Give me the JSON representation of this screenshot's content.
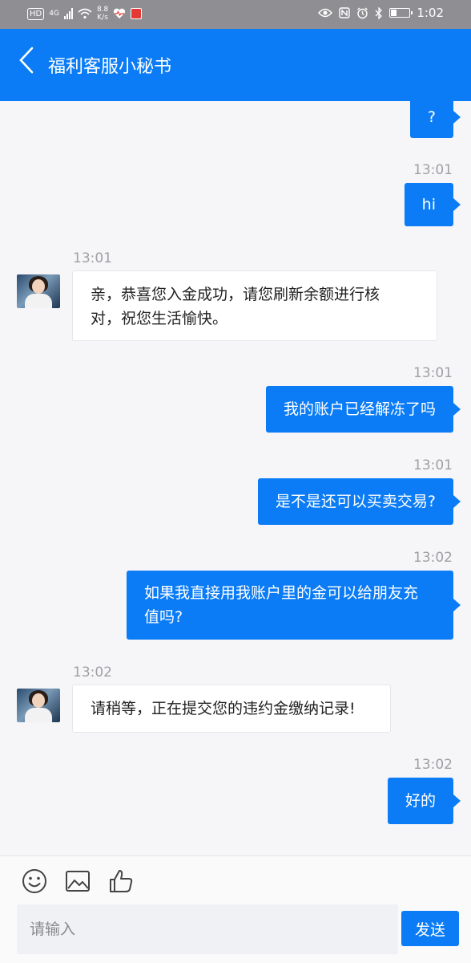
{
  "status_bar": {
    "hd": "HD",
    "network": "4G",
    "speed_top": "8.8",
    "speed_bottom": "K/s",
    "battery_level": 0.3,
    "time": "1:02"
  },
  "header": {
    "title": "福利客服小秘书"
  },
  "messages": [
    {
      "side": "out",
      "text": "?"
    },
    {
      "side": "out",
      "time": "13:01",
      "text": "hi"
    },
    {
      "side": "in",
      "time": "13:01",
      "text_lines": [
        "亲，恭喜您入金成功，请您刷新余额进行核",
        "对，祝您生活愉快。"
      ]
    },
    {
      "side": "out",
      "time": "13:01",
      "text": "我的账户已经解冻了吗"
    },
    {
      "side": "out",
      "time": "13:01",
      "text": "是不是还可以买卖交易?"
    },
    {
      "side": "out",
      "time": "13:02",
      "text_lines": [
        "如果我直接用我账户里的金可以给朋友充",
        "值吗?"
      ]
    },
    {
      "side": "in",
      "time": "13:02",
      "text": "请稍等，正在提交您的违约金缴纳记录!"
    },
    {
      "side": "out",
      "time": "13:02",
      "text": "好的"
    }
  ],
  "input_bar": {
    "placeholder": "请输入",
    "send_label": "发送",
    "icons": [
      "emoji-icon",
      "image-icon",
      "thumbs-up-icon"
    ]
  },
  "colors": {
    "accent": "#0b7cf5",
    "status_bar": "#8f8f93",
    "chat_bg": "#f6f6f8"
  }
}
